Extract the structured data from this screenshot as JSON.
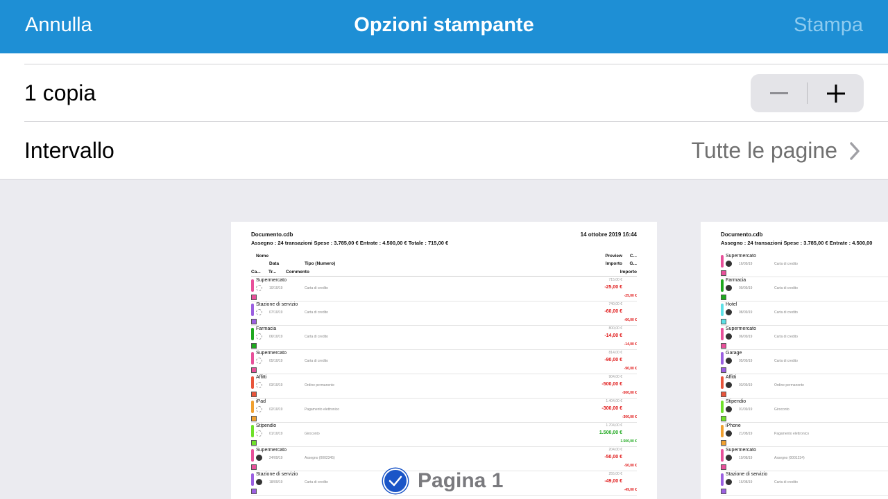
{
  "navbar": {
    "cancel": "Annulla",
    "title": "Opzioni stampante",
    "print": "Stampa"
  },
  "copies": {
    "label": "1 copia"
  },
  "range": {
    "label": "Intervallo",
    "value": "Tutte le pagine"
  },
  "page_label": "Pagina 1",
  "colors": {
    "navbar": "#1e8fd5",
    "print_disabled": "#8ecbef",
    "negative": "#e01616",
    "positive": "#1ea81e",
    "badge": "#1a55c7"
  },
  "preview1": {
    "title": "Documento.cdb",
    "date": "14 ottobre 2019 16:44",
    "summary": "Assegno : 24 transazioni    Spese : 3.785,00 €    Entrate : 4.500,00 €    Totale : 715,00 €",
    "headers": {
      "nome": "Nome",
      "data": "Data",
      "tipo": "Tipo (Numero)",
      "ca": "Ca...",
      "tr": "Tr...",
      "commento": "Commento",
      "preview": "Preview",
      "c": "C...",
      "importo": "Importo",
      "g": "G...",
      "importo2": "Importo"
    },
    "rows": [
      {
        "name": "Supermercato",
        "date": "10/10/19",
        "tipo": "Carta di credito",
        "preview": "715,00 €",
        "importo": "-25,00 €",
        "total": "-25,00 €",
        "color": "#e8509a",
        "status": "pending"
      },
      {
        "name": "Stazione di servizio",
        "date": "07/10/19",
        "tipo": "Carta di credito",
        "preview": "740,00 €",
        "importo": "-60,00 €",
        "total": "-60,00 €",
        "color": "#9b5fe0",
        "status": "pending"
      },
      {
        "name": "Farmacia",
        "date": "06/10/19",
        "tipo": "Carta di credito",
        "preview": "800,00 €",
        "importo": "-14,00 €",
        "total": "-14,00 €",
        "color": "#1ea81e",
        "status": "pending"
      },
      {
        "name": "Supermercato",
        "date": "05/10/19",
        "tipo": "Carta di credito",
        "preview": "814,00 €",
        "importo": "-90,00 €",
        "total": "-90,00 €",
        "color": "#e8509a",
        "status": "pending"
      },
      {
        "name": "Affitti",
        "date": "03/10/19",
        "tipo": "Ordine permanente",
        "preview": "904,00 €",
        "importo": "-500,00 €",
        "total": "-500,00 €",
        "color": "#e8553c",
        "status": "pending"
      },
      {
        "name": "iPad",
        "date": "02/10/19",
        "tipo": "Pagamento elettronico",
        "preview": "1.404,00 €",
        "importo": "-300,00 €",
        "total": "-300,00 €",
        "color": "#f0a030",
        "status": "pending"
      },
      {
        "name": "Stipendio",
        "date": "01/10/19",
        "tipo": "Giroconto",
        "preview": "1.704,00 €",
        "importo": "1.500,00 €",
        "total": "1.500,00 €",
        "color": "#6fe02a",
        "status": "pending",
        "positive": true
      },
      {
        "name": "Supermercato",
        "date": "24/09/19",
        "tipo": "Assegno (0002345)",
        "preview": "204,00 €",
        "importo": "-50,00 €",
        "total": "-50,00 €",
        "color": "#e8509a",
        "status": "cleared"
      },
      {
        "name": "Stazione di servizio",
        "date": "18/09/19",
        "tipo": "Carta di credito",
        "preview": "255,00 €",
        "importo": "-49,00 €",
        "total": "-49,00 €",
        "color": "#9b5fe0",
        "status": "cleared"
      }
    ]
  },
  "preview2": {
    "title": "Documento.cdb",
    "summary": "Assegno : 24 transazioni    Spese : 3.785,00 €    Entrate : 4.500,00",
    "rows": [
      {
        "name": "Supermercato",
        "date": "16/09/19",
        "tipo": "Carta di credito",
        "color": "#e8509a"
      },
      {
        "name": "Farmacia",
        "date": "09/09/19",
        "tipo": "Carta di credito",
        "color": "#1ea81e"
      },
      {
        "name": "Hotel",
        "date": "08/09/19",
        "tipo": "Carta di credito",
        "color": "#5de0e6"
      },
      {
        "name": "Supermercato",
        "date": "06/09/19",
        "tipo": "Carta di credito",
        "color": "#e8509a"
      },
      {
        "name": "Garage",
        "date": "05/09/19",
        "tipo": "Carta di credito",
        "color": "#9b5fe0"
      },
      {
        "name": "Affitti",
        "date": "03/09/19",
        "tipo": "Ordine permanente",
        "color": "#e8553c"
      },
      {
        "name": "Stipendio",
        "date": "01/09/19",
        "tipo": "Giroconto",
        "color": "#6fe02a"
      },
      {
        "name": "iPhone",
        "date": "21/08/19",
        "tipo": "Pagamento elettronico",
        "color": "#f0a030"
      },
      {
        "name": "Supermercato",
        "date": "19/08/19",
        "tipo": "Assegno (0001234)",
        "color": "#e8509a"
      },
      {
        "name": "Stazione di servizio",
        "date": "16/08/19",
        "tipo": "Carta di credito",
        "color": "#9b5fe0"
      }
    ]
  }
}
